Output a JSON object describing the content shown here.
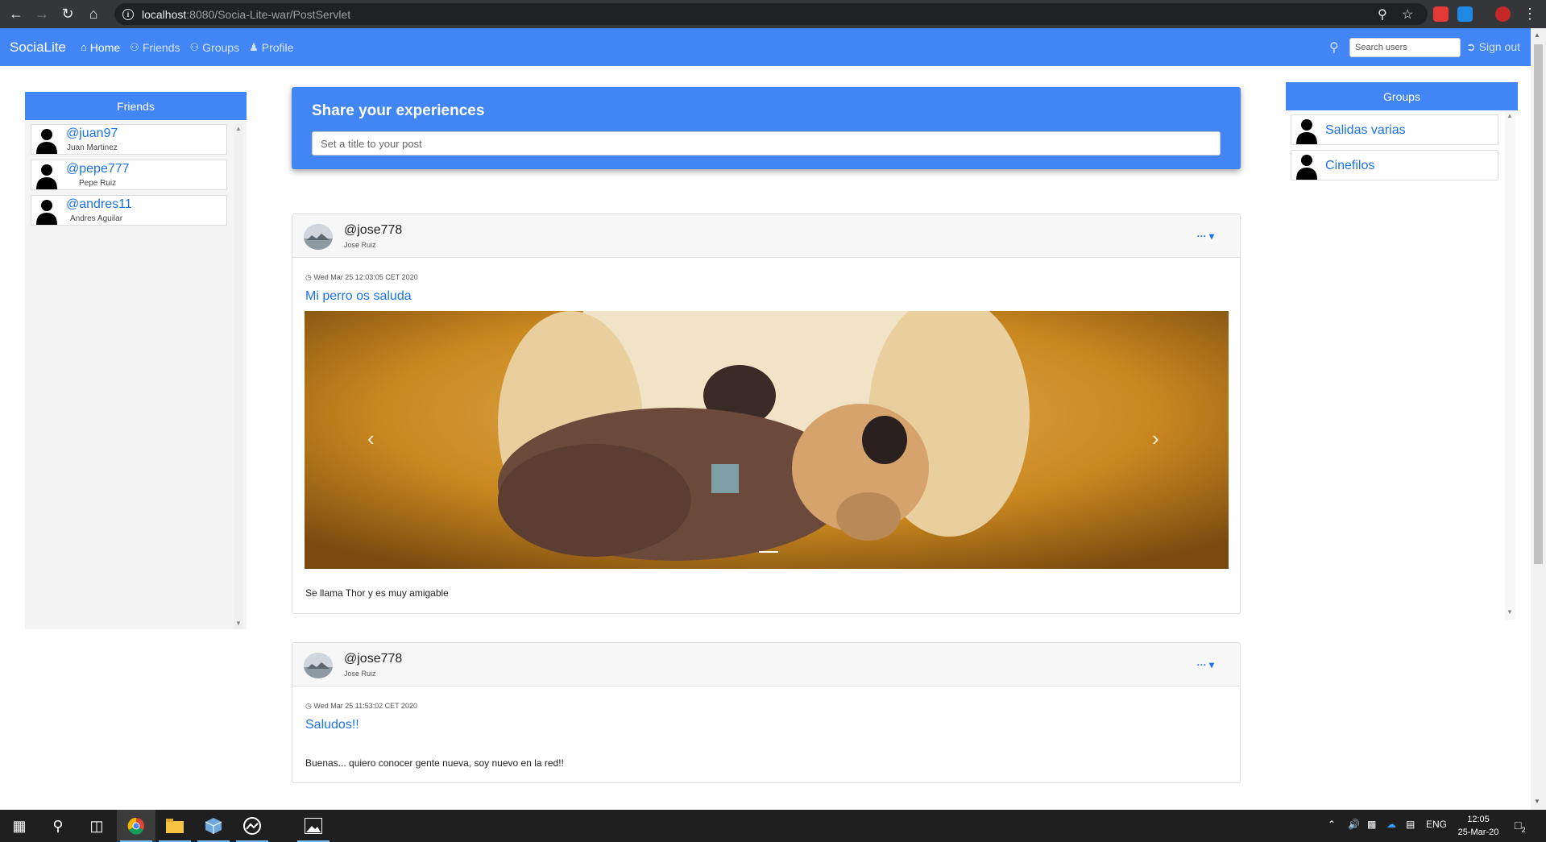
{
  "browser": {
    "url_host": "localhost",
    "url_rest": ":8080/Socia-Lite-war/PostServlet"
  },
  "navbar": {
    "brand": "SociaLite",
    "links": [
      {
        "label": "Home",
        "icon": "home-icon"
      },
      {
        "label": "Friends",
        "icon": "users-icon"
      },
      {
        "label": "Groups",
        "icon": "group-icon"
      },
      {
        "label": "Profile",
        "icon": "user-icon"
      }
    ],
    "search_placeholder": "Search users",
    "signout_label": "Sign out"
  },
  "friends": {
    "header": "Friends",
    "items": [
      {
        "handle": "@juan97",
        "name": "Juan Martinez"
      },
      {
        "handle": "@pepe777",
        "name": "Pepe Ruiz"
      },
      {
        "handle": "@andres11",
        "name": "Andres Aguilar"
      }
    ]
  },
  "share": {
    "title": "Share your experiences",
    "placeholder": "Set a title to your post"
  },
  "posts": [
    {
      "user": "@jose778",
      "name": "Jose Ruiz",
      "date": "Wed Mar 25 12:03:05 CET 2020",
      "title": "Mi perro os saluda",
      "text": "Se llama Thor y es muy amigable",
      "has_image": true
    },
    {
      "user": "@jose778",
      "name": "Jose Ruiz",
      "date": "Wed Mar 25 11:53:02 CET 2020",
      "title": "Saludos!!",
      "text": "Buenas... quiero conocer gente nueva, soy nuevo en la red!!",
      "has_image": false
    }
  ],
  "groups": {
    "header": "Groups",
    "items": [
      {
        "name": "Salidas varias"
      },
      {
        "name": "Cinefilos"
      }
    ]
  },
  "taskbar": {
    "lang": "ENG",
    "time": "12:05",
    "date": "25-Mar-20",
    "notifications": "2"
  },
  "colors": {
    "primary": "#4285f4",
    "link": "#1a73e8",
    "chrome_dark": "#35363a"
  }
}
